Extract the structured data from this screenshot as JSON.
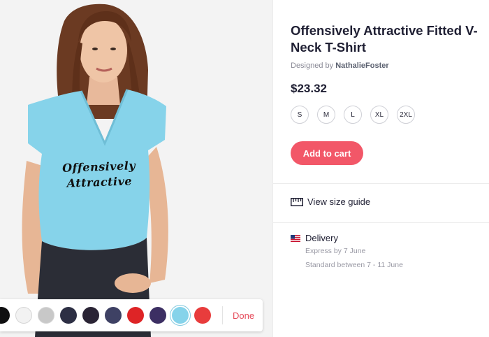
{
  "product": {
    "title": "Offensively Attractive Fitted V-Neck T-Shirt",
    "designer_prefix": "Designed by",
    "designer_name": "NathalieFoster",
    "price": "$23.32",
    "print_line1": "Offensively",
    "print_line2": "Attractive"
  },
  "sizes": [
    "S",
    "M",
    "L",
    "XL",
    "2XL"
  ],
  "actions": {
    "add_to_cart": "Add to cart",
    "size_guide": "View size guide",
    "done": "Done"
  },
  "delivery": {
    "heading": "Delivery",
    "express": "Express by 7 June",
    "standard": "Standard between 7 - 11 June"
  },
  "colors": {
    "swatches": [
      "#0f0f10",
      "#f2f2f2",
      "#c8c8c8",
      "#2d2f44",
      "#2a2435",
      "#3e4164",
      "#de2426",
      "#3c2f63",
      "#86d3ea",
      "#e83c3c"
    ],
    "selected_index": 8,
    "accent": "#f25768",
    "shirt": "#86d3ea"
  },
  "icons": {
    "size_guide": "ruler-icon",
    "delivery": "us-flag-icon"
  }
}
